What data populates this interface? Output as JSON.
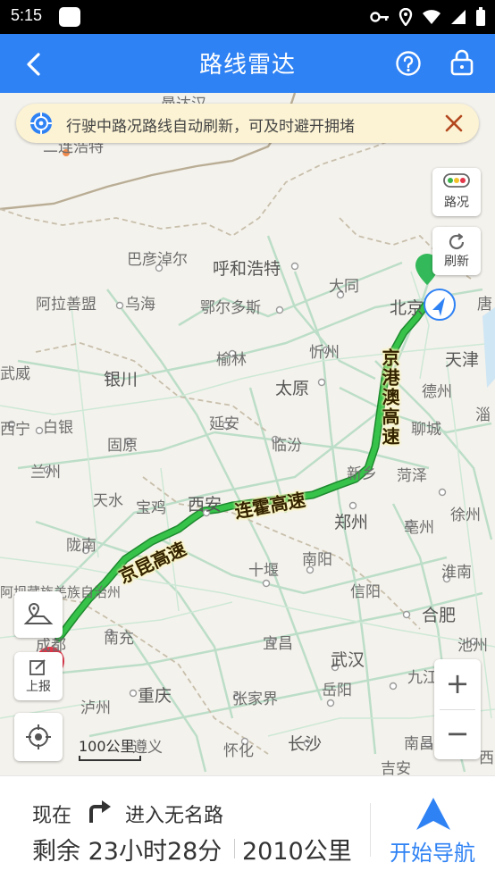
{
  "status_bar": {
    "time": "5:15"
  },
  "header": {
    "title": "路线雷达"
  },
  "banner": {
    "message": "行驶中路况路线自动刷新，可及时避开拥堵"
  },
  "side_buttons": {
    "traffic": "路况",
    "refresh": "刷新",
    "report": "上报"
  },
  "map": {
    "scale_label": "100公里",
    "highways": [
      "京港澳高速",
      "连霍高速",
      "京昆高速"
    ],
    "cities": [
      "曼达汉",
      "二连浩特",
      "巴彦淖尔",
      "呼和浩特",
      "大同",
      "北京",
      "唐",
      "阿拉善盟",
      "乌海",
      "鄂尔多斯",
      "忻州",
      "天津",
      "武威",
      "银川",
      "榆林",
      "太原",
      "德州",
      "白银",
      "西宁",
      "延安",
      "临汾",
      "聊城",
      "淄",
      "兰州",
      "固原",
      "新乡",
      "菏泽",
      "天水",
      "宝鸡",
      "西安",
      "郑州",
      "亳州",
      "徐州",
      "陇南",
      "南阳",
      "十堰",
      "淮南",
      "阿坝藏族羌族自治州",
      "信阳",
      "合肥",
      "成都",
      "南充",
      "宜昌",
      "池州",
      "武汉",
      "九江",
      "泸州",
      "重庆",
      "张家界",
      "岳阳",
      "遵义",
      "怀化",
      "长沙",
      "南昌",
      "吉安",
      "西"
    ]
  },
  "zoom": {
    "in": "+",
    "out": "−"
  },
  "bottom": {
    "now_label": "现在",
    "road_name": "进入无名路",
    "remaining_label": "剩余 23小时28分",
    "distance": "2010公里",
    "start_nav": "开始导航"
  },
  "colors": {
    "accent": "#2f82f4",
    "route": "#27a83a",
    "banner_bg": "#fcf3d4"
  }
}
